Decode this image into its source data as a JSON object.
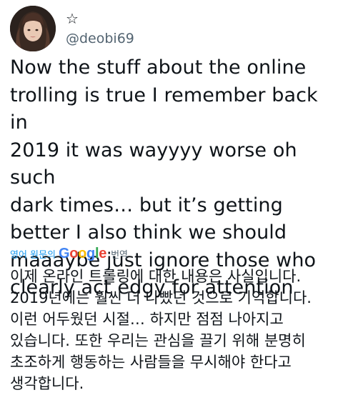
{
  "author": {
    "display_name": "☆",
    "handle": "@deobi69"
  },
  "tweet": {
    "text": "Now the stuff about the online\ntrolling is true I remember back in\n2019 it was wayyyy worse oh such\ndark times… but it’s getting\nbetter I also think we should\nmaaaybe just ignore those who\nclearly act edgy for attention"
  },
  "translation": {
    "prefix": "영어 원문의",
    "provider_letters": [
      "G",
      "o",
      "o",
      "g",
      "l",
      "e"
    ],
    "suffix": "번역",
    "text": "이제 온라인 트롤링에 대한 내용은 사실입니다.\n2019년에는 훨씬 더 나빴던 것으로 기억합니다.\n이런 어두웠던 시절… 하지만 점점 나아지고\n있습니다. 또한 우리는 관심을 끌기 위해 분명히\n초조하게 행동하는 사람들을 무시해야 한다고\n생각합니다."
  },
  "colors": {
    "text_primary": "#0f1419",
    "text_secondary": "#536471",
    "link_blue": "#1d9bf0",
    "google_blue": "#4285f4",
    "google_red": "#ea4335",
    "google_yellow": "#fbbc05",
    "google_green": "#34a853"
  },
  "icons": {
    "avatar": "profile-photo"
  }
}
